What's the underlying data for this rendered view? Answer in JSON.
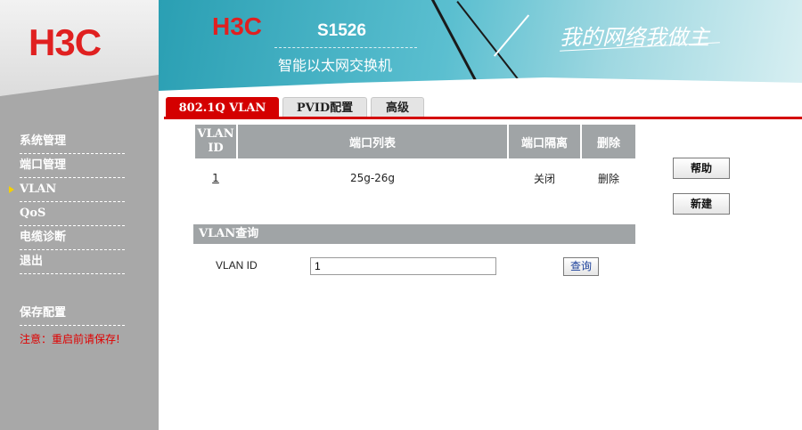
{
  "sidebar": {
    "logo": "H3C",
    "items": [
      {
        "label": "系统管理"
      },
      {
        "label": "端口管理"
      },
      {
        "label": "VLAN"
      },
      {
        "label": "QoS"
      },
      {
        "label": "电缆诊断"
      },
      {
        "label": "退出"
      }
    ],
    "active_index": 2,
    "save_config": "保存配置",
    "notice": "注意：重启前请保存!"
  },
  "banner": {
    "brand": "H3C",
    "model": "S1526",
    "subtitle": "智能以太网交换机",
    "slogan": "我的网络我做主"
  },
  "tabs": [
    {
      "label": "802.1Q VLAN",
      "active": true
    },
    {
      "label": "PVID配置",
      "active": false
    },
    {
      "label": "高级",
      "active": false
    }
  ],
  "table": {
    "headers": [
      "VLAN ID",
      "端口列表",
      "端口隔离",
      "删除"
    ],
    "rows": [
      {
        "id": "1",
        "ports": "25g-26g",
        "isolation": "关闭",
        "delete": "删除"
      }
    ]
  },
  "buttons": {
    "help": "帮助",
    "new": "新建"
  },
  "query": {
    "title": "VLAN查询",
    "label": "VLAN ID",
    "value": "1",
    "button": "查询"
  },
  "colors": {
    "accent": "#d40000",
    "sidebar": "#a8a8a8",
    "header_gray": "#a0a4a6",
    "banner": "#2a9fb3"
  }
}
